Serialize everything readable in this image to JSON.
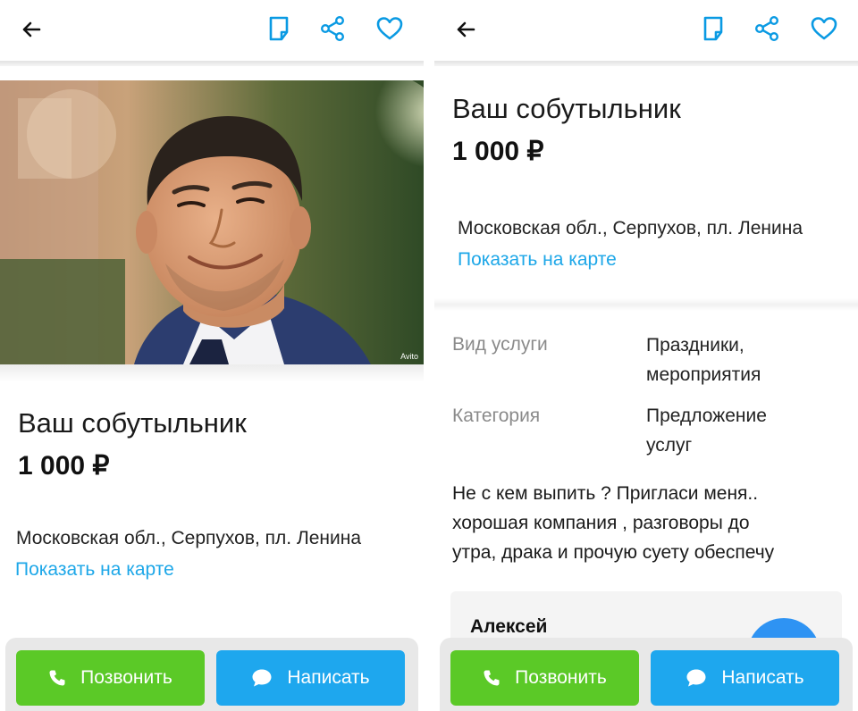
{
  "listing": {
    "title": "Ваш собутыльник",
    "price": "1 000 ₽",
    "address": "Московская обл., Серпухов, пл. Ленина",
    "map_link": "Показать на карте",
    "photo_watermark": "Avito"
  },
  "params": [
    {
      "label": "Вид услуги",
      "value_line1": "Праздники,",
      "value_line2": "мероприятия"
    },
    {
      "label": "Категория",
      "value_line1": "Предложение",
      "value_line2": "услуг"
    }
  ],
  "description": {
    "line1": "Не с кем выпить ? Пригласи меня..",
    "line2": "хорошая компания , разговоры до",
    "line3": "утра, драка и прочую суету обеспечу"
  },
  "seller": {
    "name": "Алексей"
  },
  "actions": {
    "call_label": "Позвонить",
    "write_label": "Написать"
  },
  "icons": {
    "back": "arrow-left-icon",
    "note": "note-icon",
    "share": "share-icon",
    "favorite": "heart-icon",
    "phone": "phone-icon",
    "chat": "chat-bubble-icon"
  },
  "colors": {
    "accent": "#1da7e8",
    "call_button": "#5bc927",
    "write_button": "#1ea7ee",
    "icon_blue": "#0a9ae3"
  }
}
